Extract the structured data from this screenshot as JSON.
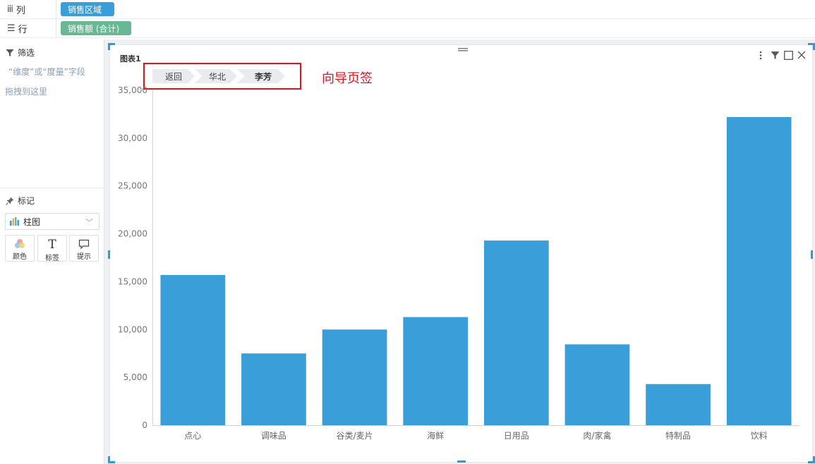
{
  "shelves": {
    "columns": {
      "label": "列",
      "pill": "销售区域"
    },
    "rows": {
      "label": "行",
      "pill": "销售额 (合计)"
    }
  },
  "filter": {
    "title": "筛选",
    "hint_line1": "“维度”或“度量”字段",
    "hint_line2": "拖拽到这里"
  },
  "marks": {
    "title": "标记",
    "chart_type": "柱图",
    "buttons": [
      {
        "label": "颜色",
        "icon": "color-palette-icon"
      },
      {
        "label": "标签",
        "icon": "text-t-icon"
      },
      {
        "label": "提示",
        "icon": "tooltip-bubble-icon"
      }
    ]
  },
  "chart_card": {
    "title": "图表1",
    "breadcrumb": [
      "返回",
      "华北",
      "李芳"
    ],
    "annotation": "向导页签"
  },
  "colors": {
    "bar": "#3a9fd8",
    "accent": "#2c9bd6",
    "annotation": "#e0141e",
    "pill_column": "#3a9fd8",
    "pill_row": "#68b894"
  },
  "chart_data": {
    "type": "bar",
    "categories": [
      "点心",
      "调味品",
      "谷类/麦片",
      "海鲜",
      "日用品",
      "肉/家禽",
      "特制品",
      "饮料"
    ],
    "values": [
      15700,
      7500,
      10000,
      11300,
      19300,
      8450,
      4300,
      32200
    ],
    "ylim": [
      0,
      35000
    ],
    "yticks": [
      0,
      5000,
      10000,
      15000,
      20000,
      25000,
      30000,
      35000
    ],
    "ytick_labels": [
      "0",
      "5,000",
      "10,000",
      "15,000",
      "20,000",
      "25,000",
      "30,000",
      "35,000"
    ],
    "grid": false
  }
}
